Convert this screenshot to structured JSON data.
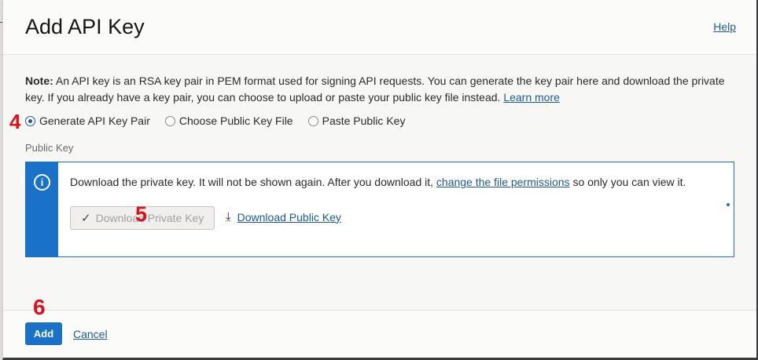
{
  "dialog": {
    "title": "Add API Key",
    "help": "Help"
  },
  "note": {
    "label": "Note:",
    "text": " An API key is an RSA key pair in PEM format used for signing API requests. You can generate the key pair here and download the private key. If you already have a key pair, you can choose to upload or paste your public key file instead. ",
    "learn_more": "Learn more"
  },
  "options": [
    {
      "label": "Generate API Key Pair",
      "selected": true
    },
    {
      "label": "Choose Public Key File",
      "selected": false
    },
    {
      "label": "Paste Public Key",
      "selected": false
    }
  ],
  "public_key_label": "Public Key",
  "info": {
    "text_before": "Download the private key. It will not be shown again. After you download it, ",
    "link": "change the file permissions",
    "text_after": " so only you can view it.",
    "download_private": "Download Private Key",
    "download_public": "Download Public Key"
  },
  "footer": {
    "add": "Add",
    "cancel": "Cancel"
  },
  "annotations": {
    "step4": "4",
    "step5": "5",
    "step6": "6"
  },
  "colors": {
    "accent": "#1a72c8",
    "link": "#1a5b96",
    "annotation": "#e0101a"
  }
}
